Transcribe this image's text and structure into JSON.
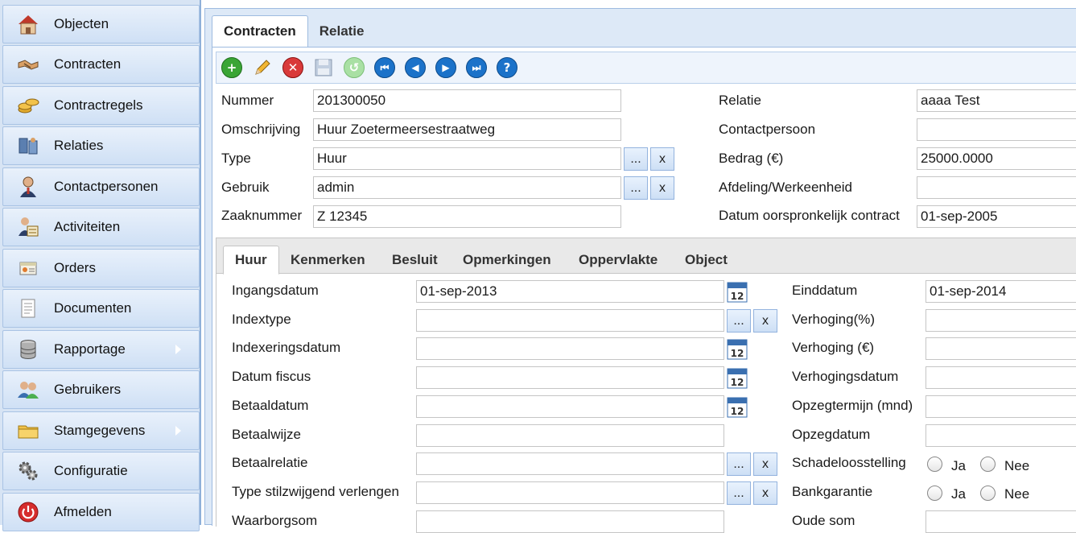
{
  "sidebar": {
    "items": [
      {
        "label": "Objecten",
        "icon": "house-icon"
      },
      {
        "label": "Contracten",
        "icon": "handshake-icon"
      },
      {
        "label": "Contractregels",
        "icon": "coins-icon"
      },
      {
        "label": "Relaties",
        "icon": "relations-icon"
      },
      {
        "label": "Contactpersonen",
        "icon": "person-icon"
      },
      {
        "label": "Activiteiten",
        "icon": "activity-icon"
      },
      {
        "label": "Orders",
        "icon": "orders-icon"
      },
      {
        "label": "Documenten",
        "icon": "document-icon"
      },
      {
        "label": "Rapportage",
        "icon": "database-icon"
      },
      {
        "label": "Gebruikers",
        "icon": "users-icon"
      },
      {
        "label": "Stamgegevens",
        "icon": "folder-icon"
      },
      {
        "label": "Configuratie",
        "icon": "gears-icon"
      },
      {
        "label": "Afmelden",
        "icon": "power-icon"
      }
    ]
  },
  "tabs": [
    {
      "label": "Contracten",
      "active": true
    },
    {
      "label": "Relatie",
      "active": false
    }
  ],
  "toolbar": {
    "buttons": [
      "add-icon",
      "edit-icon",
      "delete-icon",
      "save-icon",
      "refresh-icon",
      "first-icon",
      "previous-icon",
      "next-icon",
      "last-icon",
      "help-icon"
    ]
  },
  "form": {
    "nummer": {
      "label": "Nummer",
      "value": "201300050"
    },
    "omschrijving": {
      "label": "Omschrijving",
      "value": "Huur Zoetermeersestraatweg"
    },
    "type": {
      "label": "Type",
      "value": "Huur"
    },
    "gebruik": {
      "label": "Gebruik",
      "value": "admin"
    },
    "zaaknummer": {
      "label": "Zaaknummer",
      "value": "Z 12345"
    },
    "relatie": {
      "label": "Relatie",
      "value": "aaaa Test"
    },
    "contactpersoon": {
      "label": "Contactpersoon",
      "value": ""
    },
    "bedrag": {
      "label": "Bedrag (€)",
      "value": "25000.0000"
    },
    "afdeling": {
      "label": "Afdeling/Werkeenheid",
      "value": ""
    },
    "datum_oorspronkelijk": {
      "label": "Datum oorspronkelijk contract",
      "value": "01-sep-2005"
    },
    "lookup_label": "...",
    "clear_label": "x"
  },
  "subtabs": [
    {
      "label": "Huur",
      "active": true
    },
    {
      "label": "Kenmerken",
      "active": false
    },
    {
      "label": "Besluit",
      "active": false
    },
    {
      "label": "Opmerkingen",
      "active": false
    },
    {
      "label": "Oppervlakte",
      "active": false
    },
    {
      "label": "Object",
      "active": false
    }
  ],
  "huur": {
    "ingangsdatum": {
      "label": "Ingangsdatum",
      "value": "01-sep-2013"
    },
    "indextype": {
      "label": "Indextype",
      "value": ""
    },
    "indexeringsdatum": {
      "label": "Indexeringsdatum",
      "value": ""
    },
    "datum_fiscus": {
      "label": "Datum fiscus",
      "value": ""
    },
    "betaaldatum": {
      "label": "Betaaldatum",
      "value": ""
    },
    "betaalwijze": {
      "label": "Betaalwijze",
      "value": ""
    },
    "betaalrelatie": {
      "label": "Betaalrelatie",
      "value": ""
    },
    "type_stilzwijgend": {
      "label": "Type stilzwijgend verlengen",
      "value": ""
    },
    "waarborgsom": {
      "label": "Waarborgsom",
      "value": ""
    },
    "einddatum": {
      "label": "Einddatum",
      "value": "01-sep-2014"
    },
    "verhoging_pct": {
      "label": "Verhoging(%)",
      "value": ""
    },
    "verhoging_eur": {
      "label": "Verhoging (€)",
      "value": ""
    },
    "verhogingsdatum": {
      "label": "Verhogingsdatum",
      "value": ""
    },
    "opzegtermijn": {
      "label": "Opzegtermijn (mnd)",
      "value": ""
    },
    "opzegdatum": {
      "label": "Opzegdatum",
      "value": ""
    },
    "schadeloosstelling": {
      "label": "Schadeloosstelling",
      "ja": "Ja",
      "nee": "Nee"
    },
    "bankgarantie": {
      "label": "Bankgarantie",
      "ja": "Ja",
      "nee": "Nee"
    },
    "oude_som": {
      "label": "Oude som",
      "value": ""
    },
    "calendar_text": "12"
  }
}
